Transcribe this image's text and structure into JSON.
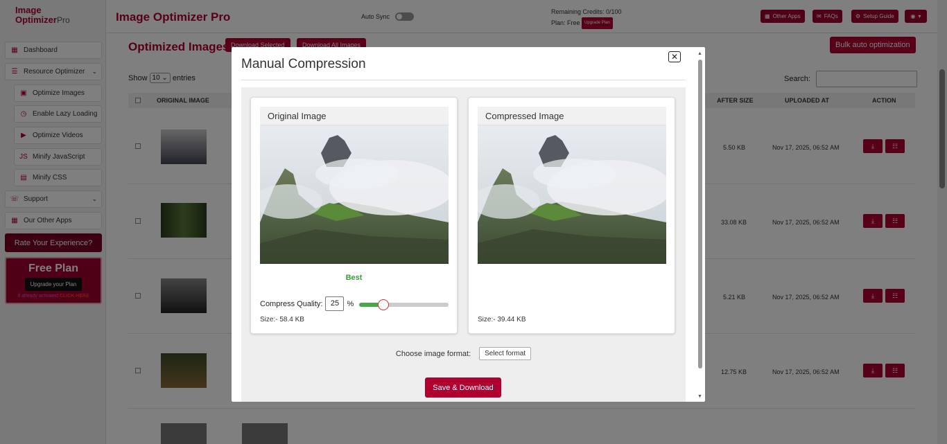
{
  "header": {
    "logo_line1": "Image",
    "logo_line2": "Optimizer",
    "logo_pro": "Pro",
    "app_title": "Image Optimizer Pro",
    "auto_sync": "Auto Sync",
    "credits": "Remaining Credits: 0/100",
    "plan": "Plan: Free",
    "upgrade_badge": "Upgrade Plan",
    "other_apps": "Other Apps",
    "faqs": "FAQs",
    "setup_guide": "Setup Guide",
    "account_icon": "user-circle-icon"
  },
  "sidebar": {
    "items": [
      {
        "label": "Dashboard",
        "icon": "dashboard-icon"
      },
      {
        "label": "Resource Optimizer",
        "icon": "list-icon"
      },
      {
        "label": "Optimize Images",
        "icon": "image-icon"
      },
      {
        "label": "Enable Lazy Loading",
        "icon": "clock-icon"
      },
      {
        "label": "Optimize Videos",
        "icon": "play-icon"
      },
      {
        "label": "Minify JavaScript",
        "icon": "js-icon"
      },
      {
        "label": "Minify CSS",
        "icon": "css-icon"
      },
      {
        "label": "Support",
        "icon": "support-icon"
      },
      {
        "label": "Our Other Apps",
        "icon": "apps-icon"
      }
    ],
    "rate": "Rate Your Experience?",
    "free_title": "Free Plan",
    "free_button": "Upgrade your Plan",
    "free_note": "If already activated",
    "free_link": "CLICK HERE"
  },
  "main": {
    "title": "Optimized Images",
    "download_selected": "Download Selected",
    "download_all": "Download All Images",
    "bulk": "Bulk auto optimization",
    "show": "Show",
    "entries_value": "10",
    "entries": "entries",
    "search": "Search:",
    "columns": {
      "original": "ORIGINAL IMAGE",
      "after_size": "AFTER SIZE",
      "uploaded_at": "UPLOADED AT",
      "action": "ACTION"
    },
    "rows": [
      {
        "after": "5.50 KB",
        "uploaded": "Nov 17, 2025, 06:52 AM"
      },
      {
        "after": "33.08 KB",
        "uploaded": "Nov 17, 2025, 06:52 AM"
      },
      {
        "after": "5.21 KB",
        "uploaded": "Nov 17, 2025, 06:52 AM"
      },
      {
        "after": "12.75 KB",
        "uploaded": "Nov 17, 2025, 06:52 AM"
      }
    ]
  },
  "modal": {
    "title": "Manual Compression",
    "original_header": "Original Image",
    "compressed_header": "Compressed Image",
    "quality_label": "Best",
    "compress_quality": "Compress Quality:",
    "quality_value": "25",
    "percent": "%",
    "slider_level": 0.27,
    "original_size": "Size:- 58.4 KB",
    "compressed_size": "Size:- 39.44 KB",
    "format_label": "Choose image format:",
    "format_button": "Select format",
    "save_button": "Save & Download"
  },
  "colors": {
    "brand": "#b00030",
    "success": "#3a9a3a"
  }
}
